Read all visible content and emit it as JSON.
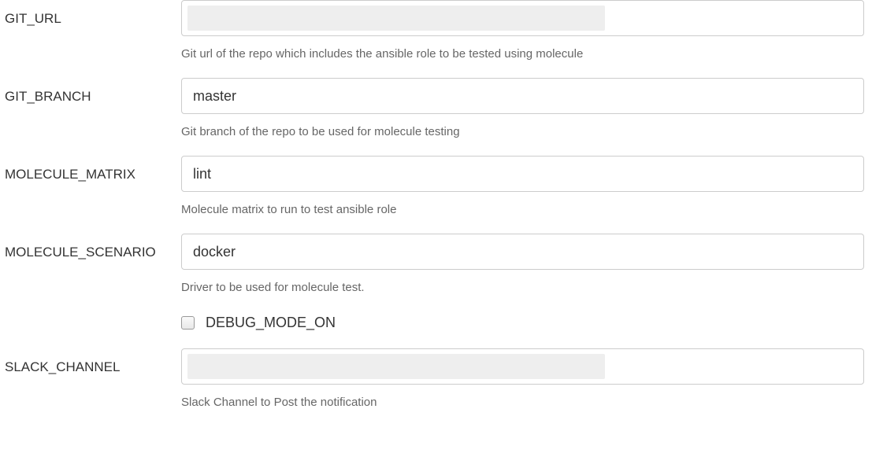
{
  "fields": {
    "git_url": {
      "label": "GIT_URL",
      "value": "",
      "help": "Git url of the repo which includes the ansible role to be tested using molecule"
    },
    "git_branch": {
      "label": "GIT_BRANCH",
      "value": "master",
      "help": "Git branch of the repo to be used for molecule testing"
    },
    "molecule_matrix": {
      "label": "MOLECULE_MATRIX",
      "value": "lint",
      "help": "Molecule matrix to run to test ansible role"
    },
    "molecule_scenario": {
      "label": "MOLECULE_SCENARIO",
      "value": "docker",
      "help": "Driver to be used for molecule test."
    },
    "debug_mode": {
      "label": "DEBUG_MODE_ON",
      "checked": false
    },
    "slack_channel": {
      "label": "SLACK_CHANNEL",
      "value": "",
      "help": "Slack Channel to Post the notification"
    }
  }
}
